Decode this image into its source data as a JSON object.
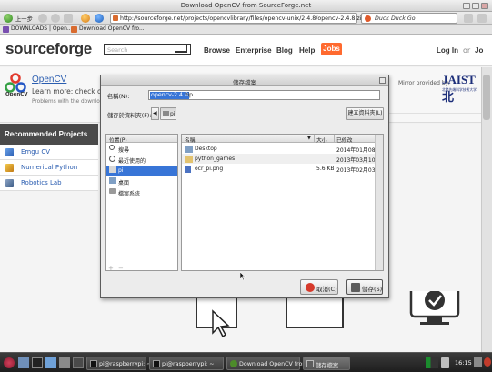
{
  "window": {
    "title": "Download OpenCV from SourceForge.net"
  },
  "toolbar": {
    "back_label": "上一步",
    "url": "http://sourceforge.net/projects/opencvlibrary/files/opencv-unix/2.4.8/opencv-2.4.8.zip/download",
    "search_placeholder": "Duck Duck Go"
  },
  "bookmarks": [
    "DOWNLOADS | Open...",
    "Download OpenCV fro..."
  ],
  "sf": {
    "logo": "sourceforge",
    "search_placeholder": "Search",
    "nav": [
      "Browse",
      "Enterprise",
      "Blog",
      "Help"
    ],
    "jobs": "Jobs",
    "login": "Log In",
    "or": "or",
    "join": "Jo"
  },
  "project": {
    "name": "OpenCV",
    "learn": "Learn more: check out",
    "problems": "Problems with the download?",
    "mirror_label": "Mirror provided by:",
    "mirror_logo": "JAIST北",
    "mirror_logo_sub": "北陸先端科学技術大学"
  },
  "recommended": {
    "title": "Recommended Projects",
    "items": [
      "Emgu CV",
      "Numerical Python",
      "Robotics Lab"
    ]
  },
  "dialog": {
    "title": "儲存檔案",
    "name_label": "名稱(N):",
    "name_selected": "opencv-2.4.8",
    "name_ext": ".zip",
    "folder_label": "儲存於資料夾(F):",
    "path_crumb": "pi",
    "new_folder": "建立資料夾(L)",
    "places_header": "位置(P)",
    "places": [
      "搜尋",
      "最近使用的",
      "pi",
      "桌面",
      "檔案系統"
    ],
    "columns": {
      "name": "名稱",
      "size": "大小",
      "modified": "已修改"
    },
    "files": [
      {
        "name": "Desktop",
        "size": "",
        "modified": "2014年01月08日"
      },
      {
        "name": "python_games",
        "size": "",
        "modified": "2013年03月10日"
      },
      {
        "name": "ocr_pi.png",
        "size": "5.6 KB",
        "modified": "2013年02月03日"
      }
    ],
    "cancel": "取消(C)",
    "save": "儲存(S)"
  },
  "taskbar": {
    "tasks": [
      "pi@raspberrypi: ~",
      "pi@raspberrypi: ~",
      "Download OpenCV from...",
      "儲存檔案"
    ],
    "clock": "16:15"
  },
  "colors": {
    "sf_accent": "#ff6a2f",
    "link": "#2a5db0",
    "selection": "#3875d7",
    "sidebar_head": "#4a4a4a"
  }
}
